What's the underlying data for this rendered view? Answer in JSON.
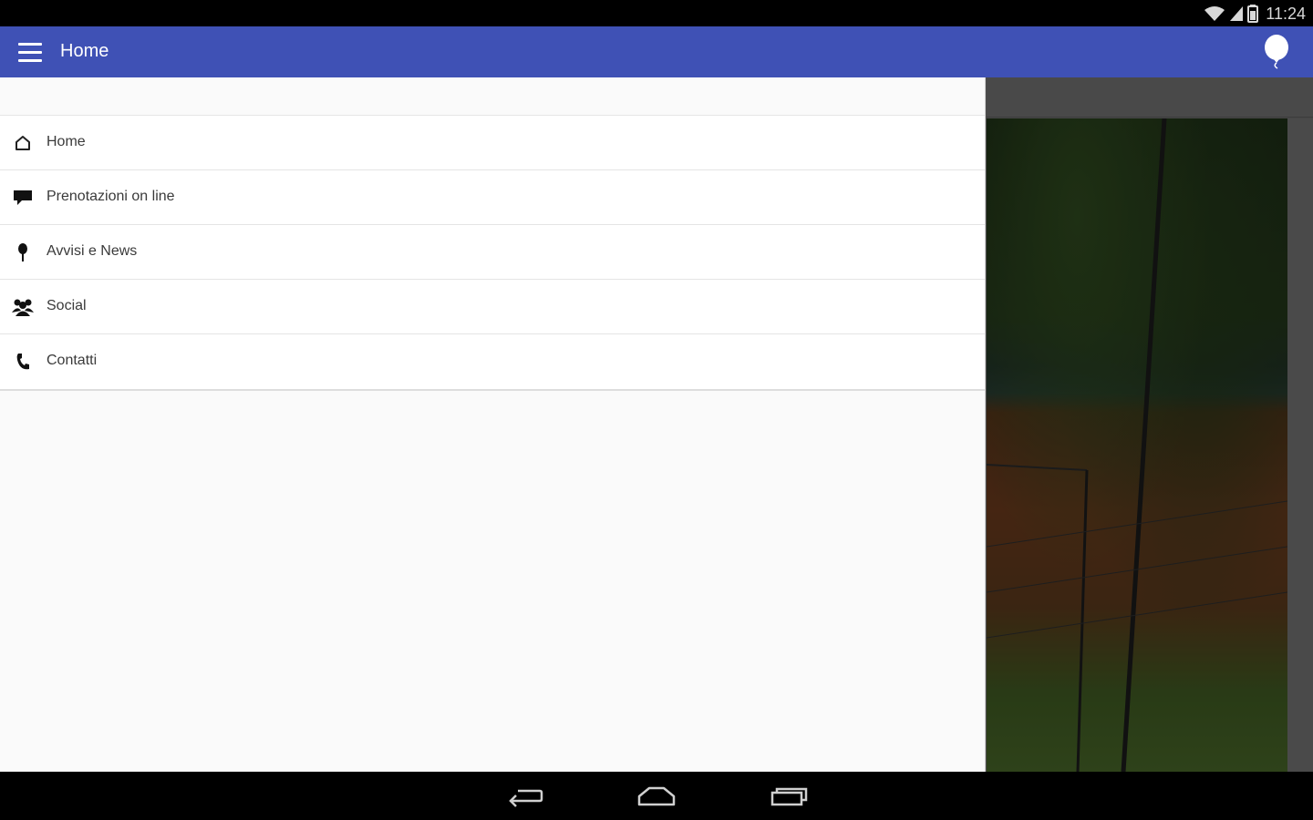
{
  "status_bar": {
    "time": "11:24",
    "icons": [
      "wifi-icon",
      "signal-icon",
      "battery-icon"
    ]
  },
  "toolbar": {
    "title": "Home",
    "menu_icon": "hamburger-menu-icon",
    "action_icon": "balloon-icon",
    "background_color": "#3f51b5"
  },
  "drawer": {
    "items": [
      {
        "label": "Home",
        "icon": "home-icon"
      },
      {
        "label": "Prenotazioni on line",
        "icon": "comment-icon"
      },
      {
        "label": "Avvisi e News",
        "icon": "pin-icon"
      },
      {
        "label": "Social",
        "icon": "group-icon"
      },
      {
        "label": "Contatti",
        "icon": "phone-icon"
      }
    ]
  },
  "background": {
    "image": "tennis-court-photo"
  },
  "navigation_bar": {
    "buttons": [
      "back-icon",
      "home-nav-icon",
      "recents-icon"
    ]
  }
}
